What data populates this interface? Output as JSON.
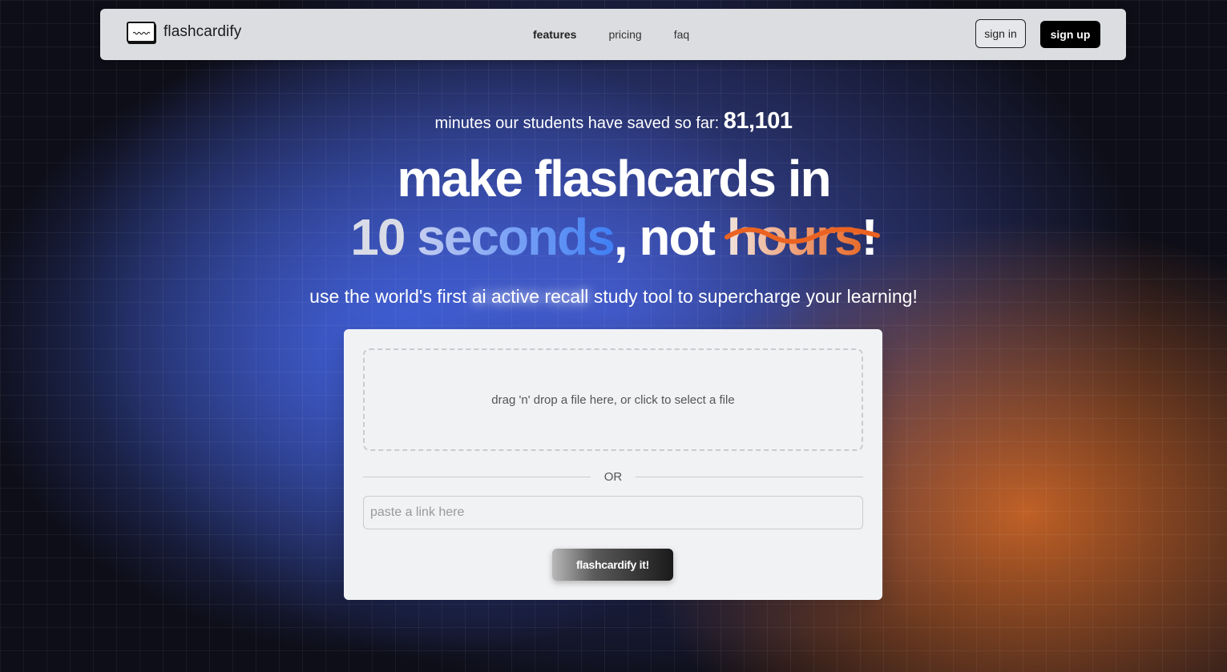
{
  "brand": {
    "name": "flashcardify",
    "logo_icon": "flashcard-icon"
  },
  "nav": {
    "links": [
      {
        "label": "features",
        "active": true
      },
      {
        "label": "pricing",
        "active": false
      },
      {
        "label": "faq",
        "active": false
      }
    ],
    "sign_in": "sign in",
    "sign_up": "sign up"
  },
  "hero": {
    "counter_label": "minutes our students have saved so far:",
    "counter_value": "81,101",
    "headline_line1": "make flashcards in",
    "headline_num": "10",
    "headline_seconds": "seconds",
    "headline_comma_not": ", not",
    "headline_hours": "hours",
    "headline_bang": "!",
    "subtitle_before": "use the world's first",
    "subtitle_highlight": "ai active recall",
    "subtitle_after": "study tool to supercharge your learning!"
  },
  "upload": {
    "dropzone_text": "drag 'n' drop a file here, or click to select a file",
    "divider_text": "OR",
    "link_placeholder": "paste a link here",
    "link_value": "",
    "submit_label": "flashcardify it!"
  },
  "colors": {
    "accent_blue": "#3f7ff4",
    "accent_orange": "#e86c2c",
    "nav_bg": "#dcdde0",
    "card_bg": "#f1f2f4"
  }
}
